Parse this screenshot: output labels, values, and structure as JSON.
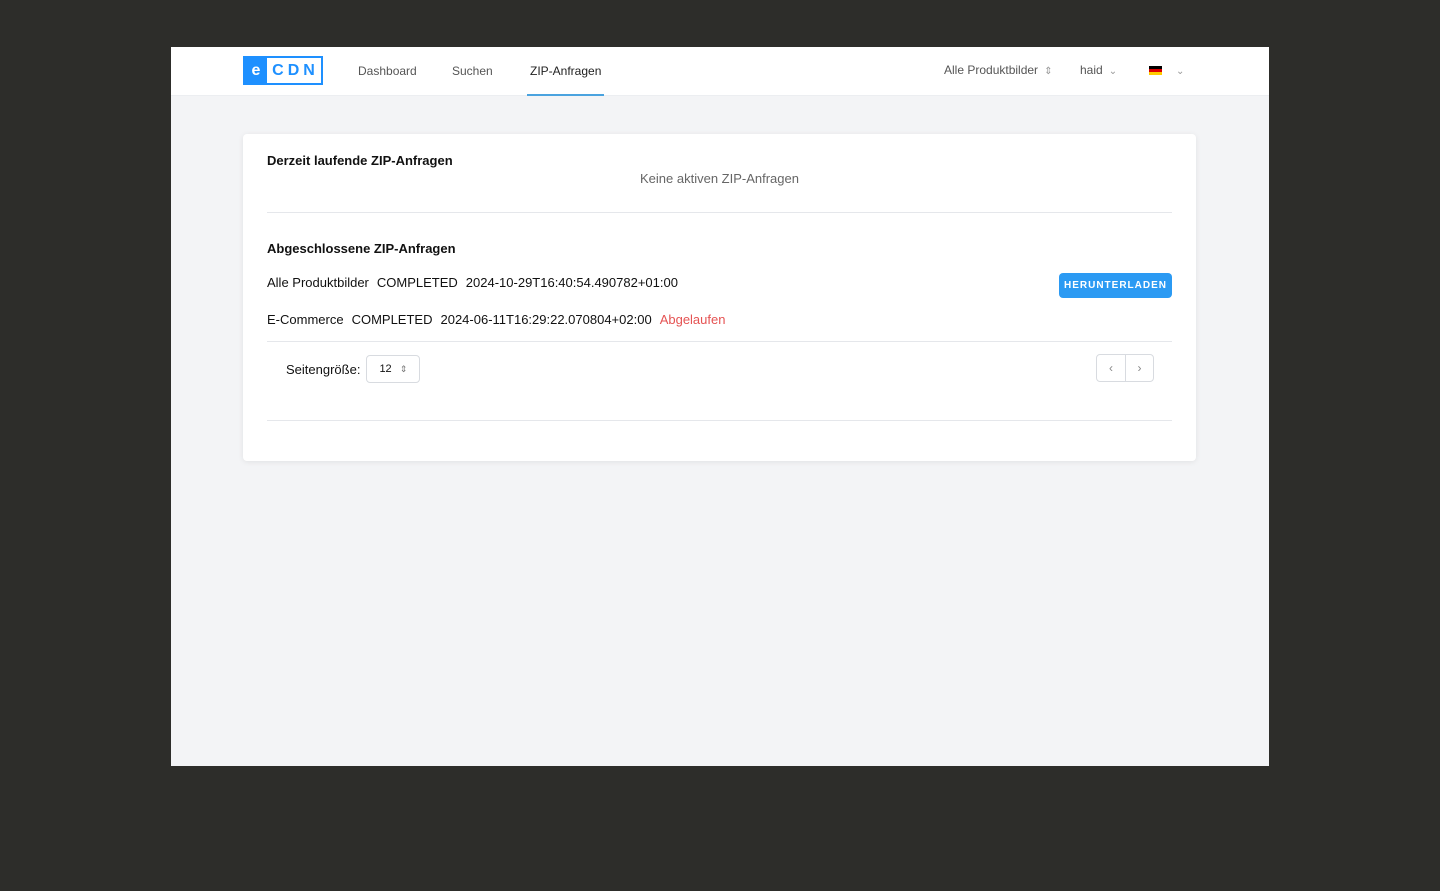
{
  "header": {
    "logo_e": "e",
    "logo_cdn": "CDN",
    "nav": [
      "Dashboard",
      "Suchen",
      "ZIP-Anfragen"
    ],
    "active_nav": "ZIP-Anfragen",
    "catalog": "Alle Produktbilder",
    "user": "haid",
    "language_icon": "flag-de"
  },
  "running": {
    "title": "Derzeit laufende ZIP-Anfragen",
    "empty": "Keine aktiven ZIP-Anfragen"
  },
  "completed": {
    "title": "Abgeschlossene ZIP-Anfragen",
    "rows": [
      {
        "name": "Alle Produktbilder",
        "status": "COMPLETED",
        "timestamp": "2024-10-29T16:40:54.490782+01:00",
        "action": "HERUNTERLADEN"
      },
      {
        "name": "E-Commerce",
        "status": "COMPLETED",
        "timestamp": "2024-06-11T16:29:22.070804+02:00",
        "expired": "Abgelaufen"
      }
    ]
  },
  "pagination": {
    "page_size_label": "Seitengröße:",
    "page_size": "12",
    "prev": "‹",
    "next": "›"
  },
  "colors": {
    "accent": "#2b9af3",
    "expired": "#e55353"
  }
}
